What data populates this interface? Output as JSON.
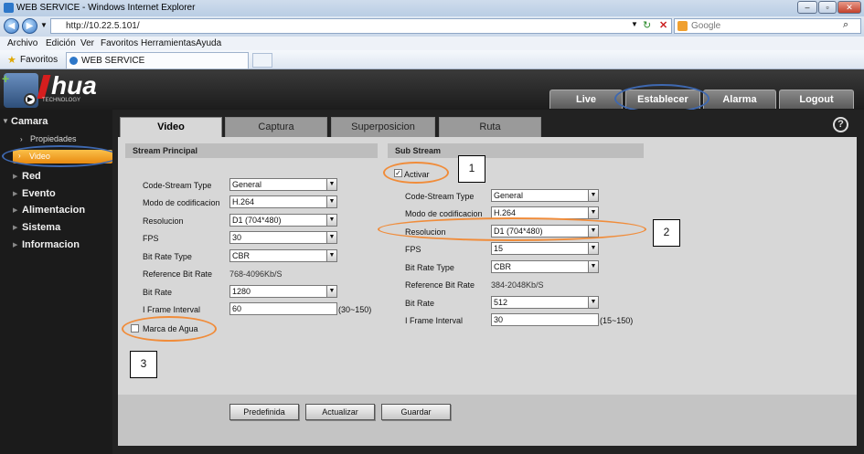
{
  "browser": {
    "title": "WEB SERVICE - Windows Internet Explorer",
    "url": "http://10.22.5.101/",
    "search_placeholder": "Google",
    "menu": [
      "Archivo",
      "Edición",
      "Ver",
      "Favoritos",
      "Herramientas",
      "Ayuda"
    ],
    "favorites_label": "Favoritos",
    "tab_label": "WEB SERVICE"
  },
  "app": {
    "logo_text": "hua",
    "logo_sub": "TECHNOLOGY",
    "nav": [
      "Live",
      "Establecer",
      "Alarma",
      "Logout"
    ],
    "sidebar": {
      "camara": "Camara",
      "propiedades": "Propiedades",
      "video": "Video",
      "items": [
        "Red",
        "Evento",
        "Alimentacion",
        "Sistema",
        "Informacion"
      ]
    },
    "tabs": [
      "Video",
      "Captura",
      "Superposicion",
      "Ruta"
    ],
    "help": "?",
    "main_stream": {
      "title": "Stream Principal",
      "labels": [
        "Code-Stream Type",
        "Modo de codificacion",
        "Resolucion",
        "FPS",
        "Bit Rate Type",
        "Reference Bit Rate",
        "Bit Rate",
        "I Frame Interval"
      ],
      "values": [
        "General",
        "H.264",
        "D1 (704*480)",
        "30",
        "CBR",
        "768-4096Kb/S",
        "1280",
        "60"
      ],
      "iframe_range": "(30~150)",
      "watermark_label": "Marca de Agua"
    },
    "sub_stream": {
      "title": "Sub Stream",
      "activar": "Activar",
      "labels": [
        "Code-Stream Type",
        "Modo de codificacion",
        "Resolucion",
        "FPS",
        "Bit Rate Type",
        "Reference Bit Rate",
        "Bit Rate",
        "I Frame Interval"
      ],
      "values": [
        "General",
        "H.264",
        "D1 (704*480)",
        "15",
        "CBR",
        "384-2048Kb/S",
        "512",
        "30"
      ],
      "iframe_range": "(15~150)"
    },
    "buttons": [
      "Predefinida",
      "Actualizar",
      "Guardar"
    ]
  },
  "annotations": [
    "1",
    "2",
    "3"
  ],
  "colors": {
    "highlight_blue": "#3e68b0",
    "highlight_orange": "#f08c3a",
    "sidebar_active": "#f5a21c"
  }
}
